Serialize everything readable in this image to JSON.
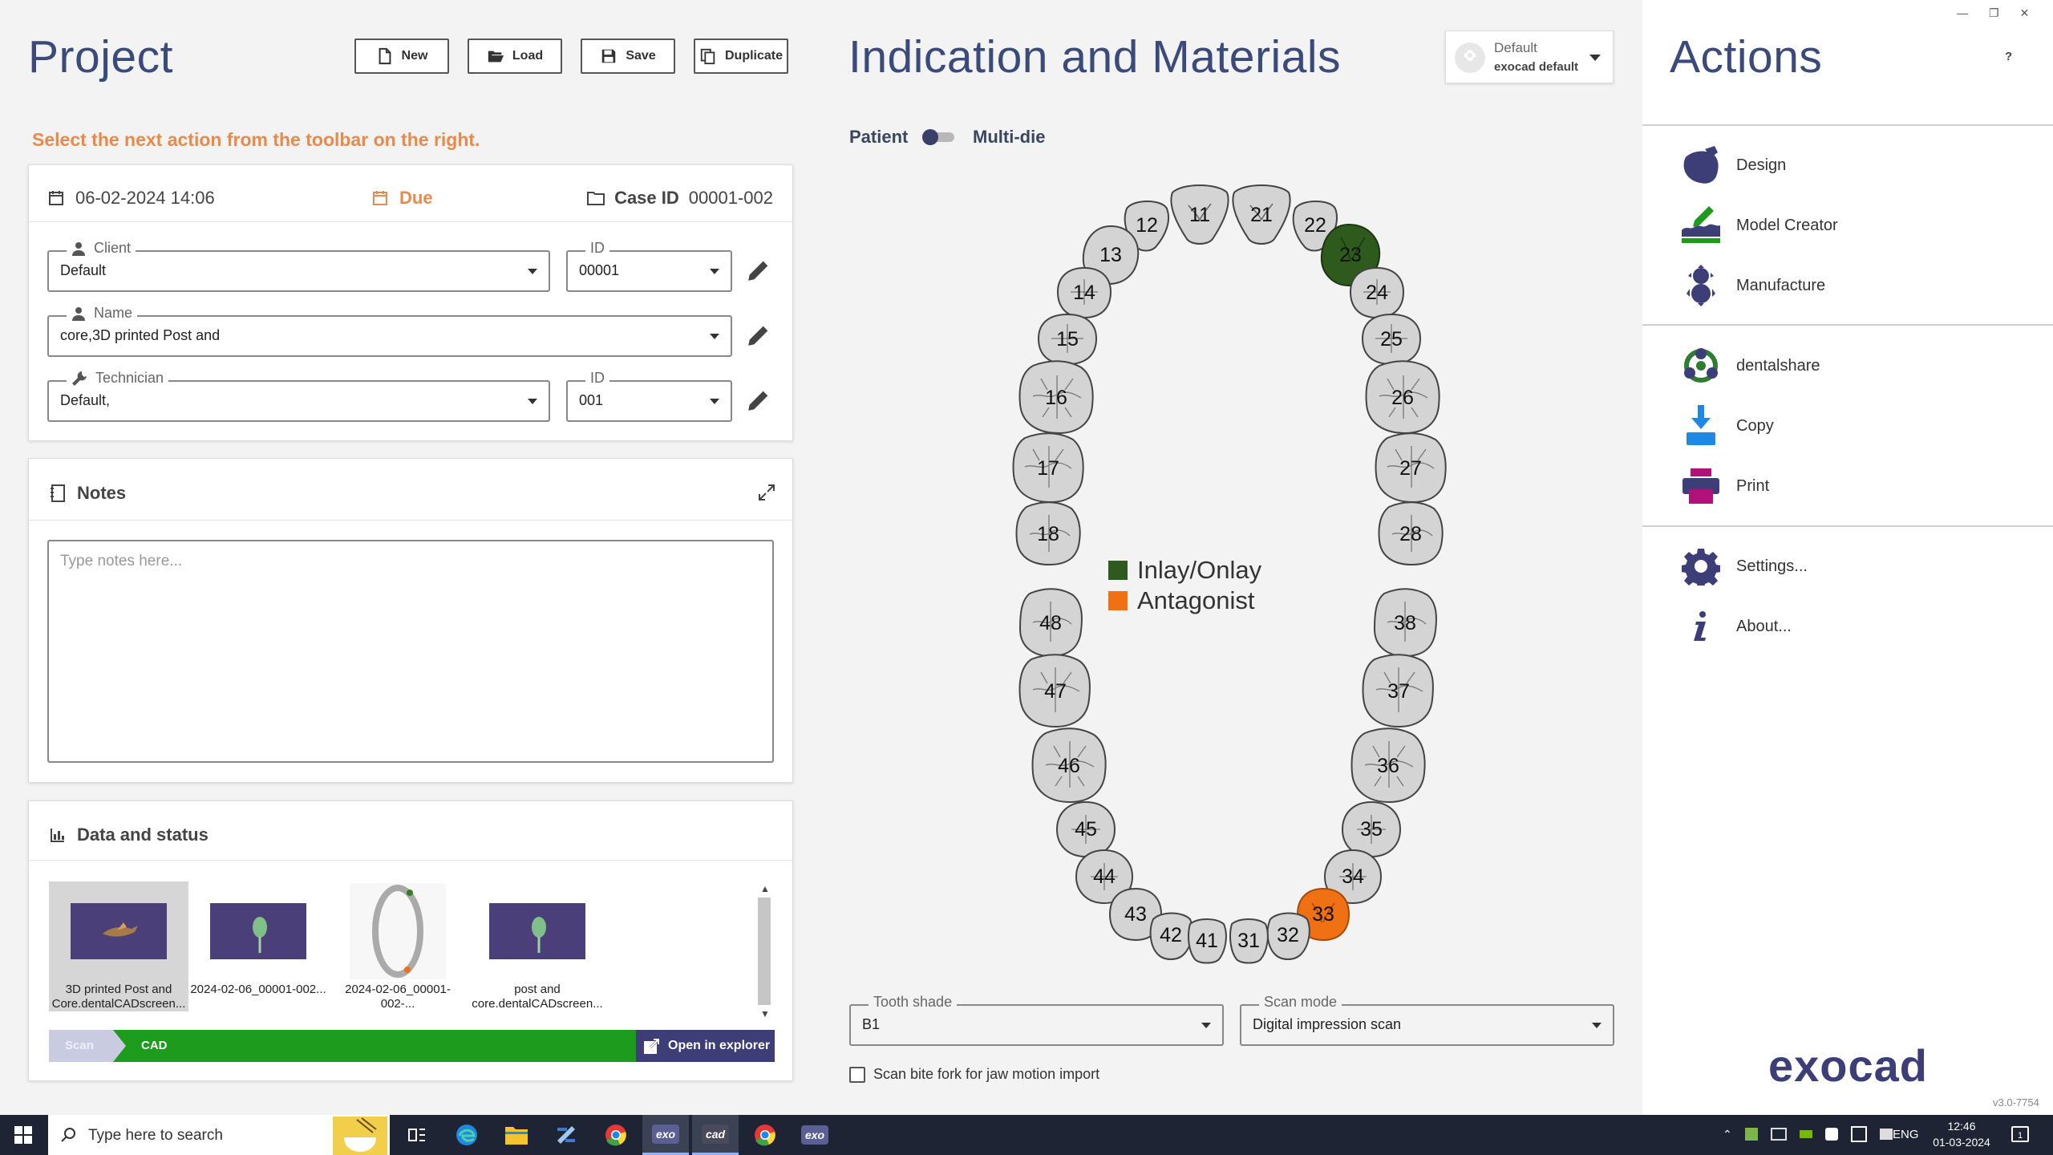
{
  "project": {
    "title": "Project",
    "toolbar": {
      "new": "New",
      "load": "Load",
      "save": "Save",
      "duplicate": "Duplicate"
    },
    "hint": "Select the next action from the toolbar on the right.",
    "date": "06-02-2024 14:06",
    "due": "Due",
    "case_id_label": "Case ID",
    "case_id": "00001-002",
    "client": {
      "label": "Client",
      "value": "Default",
      "id_label": "ID",
      "id_value": "00001"
    },
    "name": {
      "label": "Name",
      "value": "core,3D printed Post and"
    },
    "technician": {
      "label": "Technician",
      "value": "Default,",
      "id_label": "ID",
      "id_value": "001"
    },
    "notes": {
      "title": "Notes",
      "placeholder": "Type notes here..."
    },
    "data_status": {
      "title": "Data and status",
      "files": [
        {
          "line1": "3D printed Post and",
          "line2": "Core.dentalCADscreen..."
        },
        {
          "line1": "2024-02-06_00001-002...",
          "line2": ""
        },
        {
          "line1": "2024-02-06_00001-002-...",
          "line2": ""
        },
        {
          "line1": "post and",
          "line2": "core.dentalCADscreen..."
        }
      ],
      "steps": {
        "scan": "Scan",
        "cad": "CAD"
      },
      "open_explorer": "Open in explorer"
    }
  },
  "indication": {
    "title": "Indication and Materials",
    "profile": {
      "line1": "Default",
      "line2": "exocad default"
    },
    "toggle_left": "Patient",
    "toggle_right": "Multi-die",
    "legend": [
      {
        "label": "Inlay/Onlay",
        "color": "#2f5a1d"
      },
      {
        "label": "Antagonist",
        "color": "#f07014"
      }
    ],
    "teeth": {
      "t11": "11",
      "t12": "12",
      "t13": "13",
      "t14": "14",
      "t15": "15",
      "t16": "16",
      "t17": "17",
      "t18": "18",
      "t21": "21",
      "t22": "22",
      "t23": "23",
      "t24": "24",
      "t25": "25",
      "t26": "26",
      "t27": "27",
      "t28": "28",
      "t31": "31",
      "t32": "32",
      "t33": "33",
      "t34": "34",
      "t35": "35",
      "t36": "36",
      "t37": "37",
      "t38": "38",
      "t41": "41",
      "t42": "42",
      "t43": "43",
      "t44": "44",
      "t45": "45",
      "t46": "46",
      "t47": "47",
      "t48": "48"
    },
    "tooth_shade": {
      "label": "Tooth shade",
      "value": "B1"
    },
    "scan_mode": {
      "label": "Scan mode",
      "value": "Digital impression scan"
    },
    "bite_fork": "Scan bite fork for jaw motion import"
  },
  "actions": {
    "title": "Actions",
    "help": "?",
    "items": {
      "design": "Design",
      "model_creator": "Model Creator",
      "manufacture": "Manufacture",
      "dentalshare": "dentalshare",
      "copy": "Copy",
      "print": "Print",
      "settings": "Settings...",
      "about": "About..."
    },
    "logo": "exocad",
    "version": "v3.0-7754"
  },
  "taskbar": {
    "search_placeholder": "Type here to search",
    "lang": "ENG",
    "time": "12:46",
    "date": "01-03-2024",
    "notifications": "1"
  }
}
